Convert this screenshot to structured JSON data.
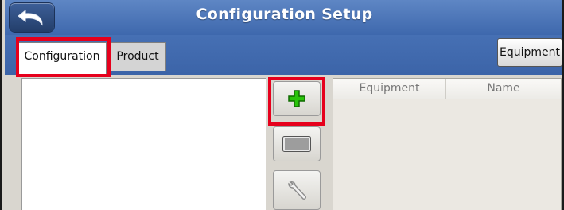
{
  "window": {
    "title": "Configuration Setup"
  },
  "tabs": [
    {
      "label": "Configuration",
      "active": true
    },
    {
      "label": "Product",
      "active": false
    }
  ],
  "toolbar": {
    "equipment_button_label": "Equipment"
  },
  "tools": [
    {
      "icon": "add-icon"
    },
    {
      "icon": "keyboard-icon"
    },
    {
      "icon": "wrench-icon"
    }
  ],
  "table": {
    "columns": [
      "Equipment",
      "Name"
    ],
    "rows": []
  },
  "colors": {
    "title_bar": "#4a74b8",
    "highlight": "#e6001c",
    "add_icon": "#22b000"
  }
}
